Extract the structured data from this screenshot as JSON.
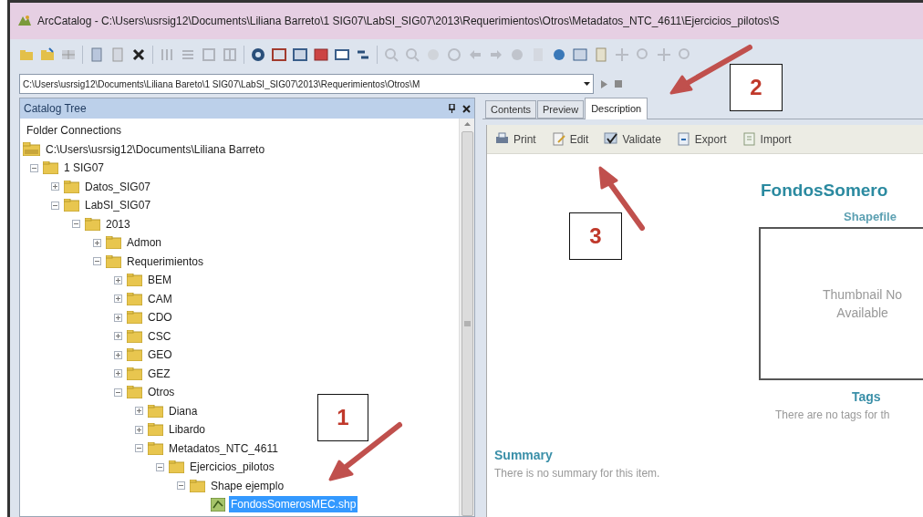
{
  "window": {
    "title": "ArcCatalog - C:\\Users\\usrsig12\\Documents\\Liliana Barreto\\1 SIG07\\LabSI_SIG07\\2013\\Requerimientos\\Otros\\Metadatos_NTC_4611\\Ejercicios_pilotos\\S"
  },
  "address_bar": {
    "value": "C:\\Users\\usrsig12\\Documents\\Liliana Bareto\\1 SIG07\\LabSI_SIG07\\2013\\Requerimientos\\Otros\\M"
  },
  "catalog_tree": {
    "title": "Catalog Tree",
    "items": [
      {
        "label": "Folder Connections",
        "kind": "heading",
        "selected": false,
        "children": [
          {
            "label": "C:\\Users\\usrsig12\\Documents\\Liliana Barreto",
            "kind": "connection",
            "selected": false,
            "children": [
              {
                "label": "1 SIG07",
                "kind": "folder",
                "expanded": true,
                "selected": false,
                "children": [
                  {
                    "label": "Datos_SIG07",
                    "kind": "folder",
                    "expanded": false,
                    "selected": false
                  },
                  {
                    "label": "LabSI_SIG07",
                    "kind": "folder",
                    "expanded": true,
                    "selected": false,
                    "children": [
                      {
                        "label": "2013",
                        "kind": "folder",
                        "expanded": true,
                        "selected": false,
                        "children": [
                          {
                            "label": "Admon",
                            "kind": "folder",
                            "expanded": false,
                            "selected": false
                          },
                          {
                            "label": "Requerimientos",
                            "kind": "folder",
                            "expanded": true,
                            "selected": false,
                            "children": [
                              {
                                "label": "BEM",
                                "kind": "folder",
                                "expanded": false,
                                "selected": false
                              },
                              {
                                "label": "CAM",
                                "kind": "folder",
                                "expanded": false,
                                "selected": false
                              },
                              {
                                "label": "CDO",
                                "kind": "folder",
                                "expanded": false,
                                "selected": false
                              },
                              {
                                "label": "CSC",
                                "kind": "folder",
                                "expanded": false,
                                "selected": false
                              },
                              {
                                "label": "GEO",
                                "kind": "folder",
                                "expanded": false,
                                "selected": false
                              },
                              {
                                "label": "GEZ",
                                "kind": "folder",
                                "expanded": false,
                                "selected": false
                              },
                              {
                                "label": "Otros",
                                "kind": "folder",
                                "expanded": true,
                                "selected": false,
                                "children": [
                                  {
                                    "label": "Diana",
                                    "kind": "folder",
                                    "expanded": false,
                                    "selected": false
                                  },
                                  {
                                    "label": "Libardo",
                                    "kind": "folder",
                                    "expanded": false,
                                    "selected": false
                                  },
                                  {
                                    "label": "Metadatos_NTC_4611",
                                    "kind": "folder",
                                    "expanded": true,
                                    "selected": false,
                                    "children": [
                                      {
                                        "label": "Ejercicios_pilotos",
                                        "kind": "folder",
                                        "expanded": true,
                                        "selected": false,
                                        "children": [
                                          {
                                            "label": "Shape ejemplo",
                                            "kind": "folder",
                                            "expanded": true,
                                            "selected": false,
                                            "children": [
                                              {
                                                "label": "FondosSomerosMEC.shp",
                                                "kind": "shapefile",
                                                "selected": true
                                              }
                                            ]
                                          }
                                        ]
                                      }
                                    ]
                                  }
                                ]
                              }
                            ]
                          }
                        ]
                      }
                    ]
                  }
                ]
              }
            ]
          }
        ]
      }
    ]
  },
  "tabs": [
    {
      "label": "Contents",
      "selected": false
    },
    {
      "label": "Preview",
      "selected": false
    },
    {
      "label": "Description",
      "selected": true
    }
  ],
  "description_toolbar": [
    {
      "label": "Print",
      "kind": "print"
    },
    {
      "label": "Edit",
      "kind": "edit"
    },
    {
      "label": "Validate",
      "kind": "validate"
    },
    {
      "label": "Export",
      "kind": "export"
    },
    {
      "label": "Import",
      "kind": "import"
    }
  ],
  "description": {
    "item_title": "FondosSomero",
    "item_type": "Shapefile",
    "thumbnail_text": [
      "Thumbnail No",
      "Available"
    ],
    "tags_heading": "Tags",
    "tags_text": "There are no tags for th",
    "summary_heading": "Summary",
    "summary_text": "There is no summary for this item."
  },
  "callouts": [
    {
      "label": "2"
    },
    {
      "label": "3"
    },
    {
      "label": "1"
    }
  ]
}
